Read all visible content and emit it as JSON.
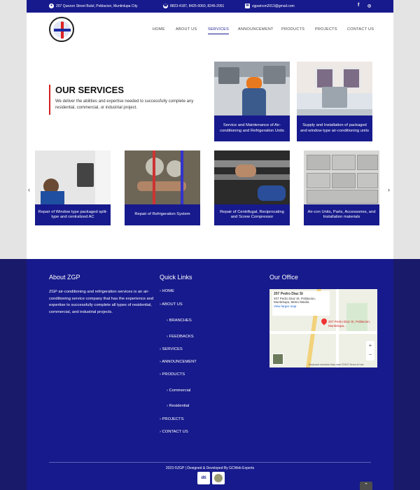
{
  "topbar": {
    "address": "207 Quezon Street Bulol, Poblacion, Muntinlupa City",
    "phone": "8823-4187, 8425-0060, 8245-2051",
    "email": "zgpaircon2013@gmail.com"
  },
  "nav": {
    "items": [
      "HOME",
      "ABOUT US",
      "SERVICES",
      "ANNOUNCEMENT",
      "PRODUCTS",
      "PROJECTS",
      "CONTACT US"
    ],
    "active": "SERVICES"
  },
  "services": {
    "title": "OUR SERVICES",
    "description": "We deliver the abilities and expertise needed to successfully complete any residential, commercial, or industrial project.",
    "top_cards": [
      "Service and Maintenance of Air-conditioning and Refrigeration Units",
      "Supply and Installation of packaged and window type air-conditioning units"
    ],
    "carousel_cards": [
      "Repair of Window type packaged split-type and centralized AC",
      "Repair of Refrigeration System",
      "Repair of Centrifugal, Reciprocating and Screw Compressor",
      "Air-con Units, Parts, Accessories, and Installation materials"
    ],
    "arrow_prev": "‹",
    "arrow_next": "›"
  },
  "footer": {
    "about_title": "About ZGP",
    "about_text": "ZGP air-conditioning and refrigeration services is an air-conditioning service company that has the experience and expertise to successfully complete all types of residential, commercial, and industrial projects.",
    "links_title": "Quick Links",
    "links": {
      "home": "› HOME",
      "about": "› ABOUT US",
      "branches": "› BRANCHES",
      "feedbacks": "› FEEDBACKS",
      "services": "› SERVICES",
      "announcement": "› ANNOUNCEMENT",
      "products": "› PRODUCTS",
      "commercial": "› Commercial",
      "residential": "› Residential",
      "projects": "› PROJECTS",
      "contact": "› CONTACT US"
    },
    "office_title": "Our Office",
    "map": {
      "place": "207 Pedro Diaz St",
      "address": "207 Pedro Diaz St, Poblacion, Muntinlupa, Metro Manila",
      "view_link": "View larger map",
      "pin_label": "207 Pedro Diaz St, Poblacion, Muntinlupa...",
      "zoom_in": "+",
      "zoom_out": "−",
      "attribution": "Keyboard shortcuts  Map data ©2023  Terms of Use"
    },
    "copyright": "2023 ©ZGP | Designed & Developed By GCWeb Experts",
    "badge1": "dti",
    "to_top": "⌃"
  },
  "colors": {
    "brand_blue": "#171a8c",
    "accent_red": "#d32020"
  }
}
